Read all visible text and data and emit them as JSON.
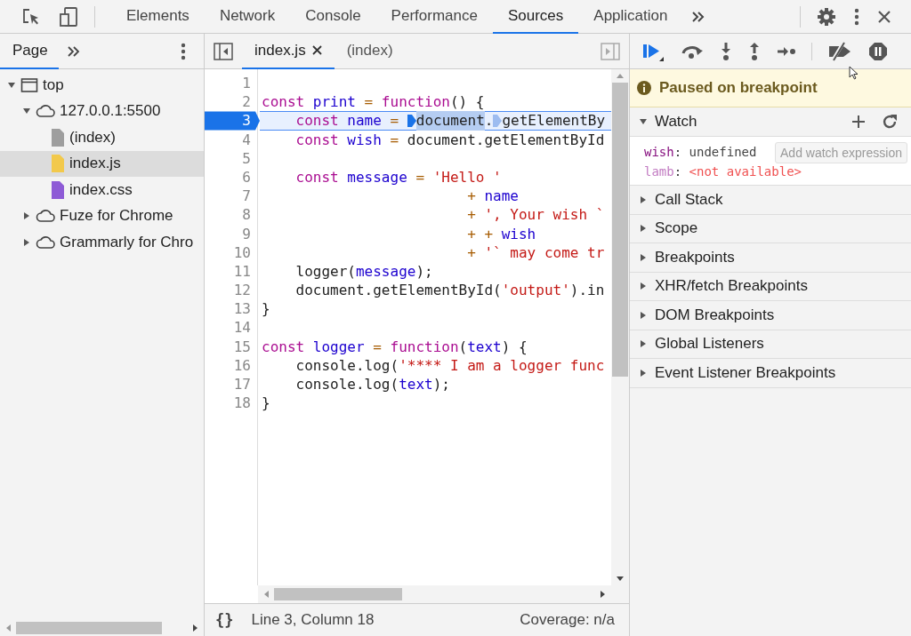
{
  "toolbar": {
    "tabs": [
      {
        "label": "Elements",
        "selected": false
      },
      {
        "label": "Network",
        "selected": false
      },
      {
        "label": "Console",
        "selected": false
      },
      {
        "label": "Performance",
        "selected": false
      },
      {
        "label": "Sources",
        "selected": true
      },
      {
        "label": "Application",
        "selected": false
      }
    ]
  },
  "navigator": {
    "tabs": [
      {
        "label": "Page",
        "selected": true
      }
    ],
    "tree": [
      {
        "label": "top",
        "kind": "frame",
        "expanded": true,
        "selected": false,
        "children": [
          {
            "label": "127.0.0.1:5500",
            "kind": "cloud",
            "expanded": true,
            "selected": false,
            "children": [
              {
                "label": "(index)",
                "kind": "file",
                "color": "#9e9e9e",
                "selected": false
              },
              {
                "label": "index.js",
                "kind": "file",
                "color": "#f2c94c",
                "selected": true
              },
              {
                "label": "index.css",
                "kind": "file",
                "color": "#8e5bd6",
                "selected": false
              }
            ]
          },
          {
            "label": "Fuze for Chrome",
            "kind": "cloud",
            "expanded": false,
            "selected": false
          },
          {
            "label": "Grammarly for Chro",
            "kind": "cloud",
            "expanded": false,
            "selected": false
          }
        ]
      }
    ]
  },
  "editor": {
    "tabs": [
      {
        "label": "index.js",
        "selected": true,
        "closable": true
      },
      {
        "label": "(index)",
        "selected": false,
        "closable": false
      }
    ],
    "lines": [
      {
        "number": "1",
        "current": false
      },
      {
        "number": "2",
        "current": false,
        "tokens": [
          {
            "kind": "kw",
            "text": "const "
          },
          {
            "kind": "def",
            "text": "print "
          },
          {
            "kind": "op",
            "text": "= "
          },
          {
            "kind": "kw",
            "text": "function"
          },
          {
            "kind": "txt",
            "text": "() {"
          }
        ]
      },
      {
        "number": "3",
        "current": true,
        "tokens": [
          {
            "kind": "kw",
            "text": "    const ",
            "selected": false
          },
          {
            "kind": "def",
            "text": "name ",
            "selected": false
          },
          {
            "kind": "op",
            "text": "= ",
            "selected": false
          },
          {
            "kind": "bp",
            "active": true,
            "selected": false
          },
          {
            "kind": "txt",
            "text": "document",
            "selected": true
          },
          {
            "kind": "txt",
            "text": ".",
            "selected": false
          },
          {
            "kind": "bp",
            "active": false,
            "selected": false
          },
          {
            "kind": "txt",
            "text": "getElementBy",
            "selected": false
          }
        ]
      },
      {
        "number": "4",
        "current": false,
        "tokens": [
          {
            "kind": "kw",
            "text": "    const "
          },
          {
            "kind": "def",
            "text": "wish "
          },
          {
            "kind": "op",
            "text": "= "
          },
          {
            "kind": "txt",
            "text": "document.getElementById"
          }
        ]
      },
      {
        "number": "5",
        "current": false
      },
      {
        "number": "6",
        "current": false,
        "tokens": [
          {
            "kind": "kw",
            "text": "    const "
          },
          {
            "kind": "def",
            "text": "message "
          },
          {
            "kind": "op",
            "text": "= "
          },
          {
            "kind": "str",
            "text": "'Hello '"
          }
        ]
      },
      {
        "number": "7",
        "current": false,
        "tokens": [
          {
            "kind": "op",
            "text": "                        + "
          },
          {
            "kind": "def",
            "text": "name"
          }
        ]
      },
      {
        "number": "8",
        "current": false,
        "tokens": [
          {
            "kind": "op",
            "text": "                        + "
          },
          {
            "kind": "str",
            "text": "', Your wish `"
          }
        ]
      },
      {
        "number": "9",
        "current": false,
        "tokens": [
          {
            "kind": "op",
            "text": "                        + + "
          },
          {
            "kind": "def",
            "text": "wish"
          }
        ]
      },
      {
        "number": "10",
        "current": false,
        "tokens": [
          {
            "kind": "op",
            "text": "                        + "
          },
          {
            "kind": "str",
            "text": "'` may come tr"
          }
        ]
      },
      {
        "number": "11",
        "current": false,
        "tokens": [
          {
            "kind": "txt",
            "text": "    logger("
          },
          {
            "kind": "def",
            "text": "message"
          },
          {
            "kind": "txt",
            "text": ");"
          }
        ]
      },
      {
        "number": "12",
        "current": false,
        "tokens": [
          {
            "kind": "txt",
            "text": "    document.getElementById("
          },
          {
            "kind": "str",
            "text": "'output'"
          },
          {
            "kind": "txt",
            "text": ").in"
          }
        ]
      },
      {
        "number": "13",
        "current": false,
        "tokens": [
          {
            "kind": "txt",
            "text": "}"
          }
        ]
      },
      {
        "number": "14",
        "current": false
      },
      {
        "number": "15",
        "current": false,
        "tokens": [
          {
            "kind": "kw",
            "text": "const "
          },
          {
            "kind": "def",
            "text": "logger "
          },
          {
            "kind": "op",
            "text": "= "
          },
          {
            "kind": "kw",
            "text": "function"
          },
          {
            "kind": "txt",
            "text": "("
          },
          {
            "kind": "def",
            "text": "text"
          },
          {
            "kind": "txt",
            "text": ") {"
          }
        ]
      },
      {
        "number": "16",
        "current": false,
        "tokens": [
          {
            "kind": "txt",
            "text": "    console.log("
          },
          {
            "kind": "str",
            "text": "'**** I am a logger func"
          }
        ]
      },
      {
        "number": "17",
        "current": false,
        "tokens": [
          {
            "kind": "txt",
            "text": "    console.log("
          },
          {
            "kind": "def",
            "text": "text"
          },
          {
            "kind": "txt",
            "text": ");"
          }
        ]
      },
      {
        "number": "18",
        "current": false,
        "tokens": [
          {
            "kind": "txt",
            "text": "}"
          }
        ]
      }
    ],
    "status": {
      "pretty_print": "{}",
      "position": "Line 3, Column 18",
      "coverage": "Coverage: n/a"
    }
  },
  "debugger": {
    "banner": "Paused on breakpoint",
    "watch": {
      "title": "Watch",
      "expanded": true,
      "items": [
        {
          "name": "wish",
          "separator": ": ",
          "value": "undefined",
          "available": true
        },
        {
          "name": "lamb",
          "separator": ": ",
          "value": "<not available>",
          "available": false
        }
      ],
      "tooltip": "Add watch expression"
    },
    "sections": [
      {
        "title": "Call Stack",
        "expanded": false
      },
      {
        "title": "Scope",
        "expanded": false
      },
      {
        "title": "Breakpoints",
        "expanded": false
      },
      {
        "title": "XHR/fetch Breakpoints",
        "expanded": false
      },
      {
        "title": "DOM Breakpoints",
        "expanded": false
      },
      {
        "title": "Global Listeners",
        "expanded": false
      },
      {
        "title": "Event Listener Breakpoints",
        "expanded": false
      }
    ]
  }
}
